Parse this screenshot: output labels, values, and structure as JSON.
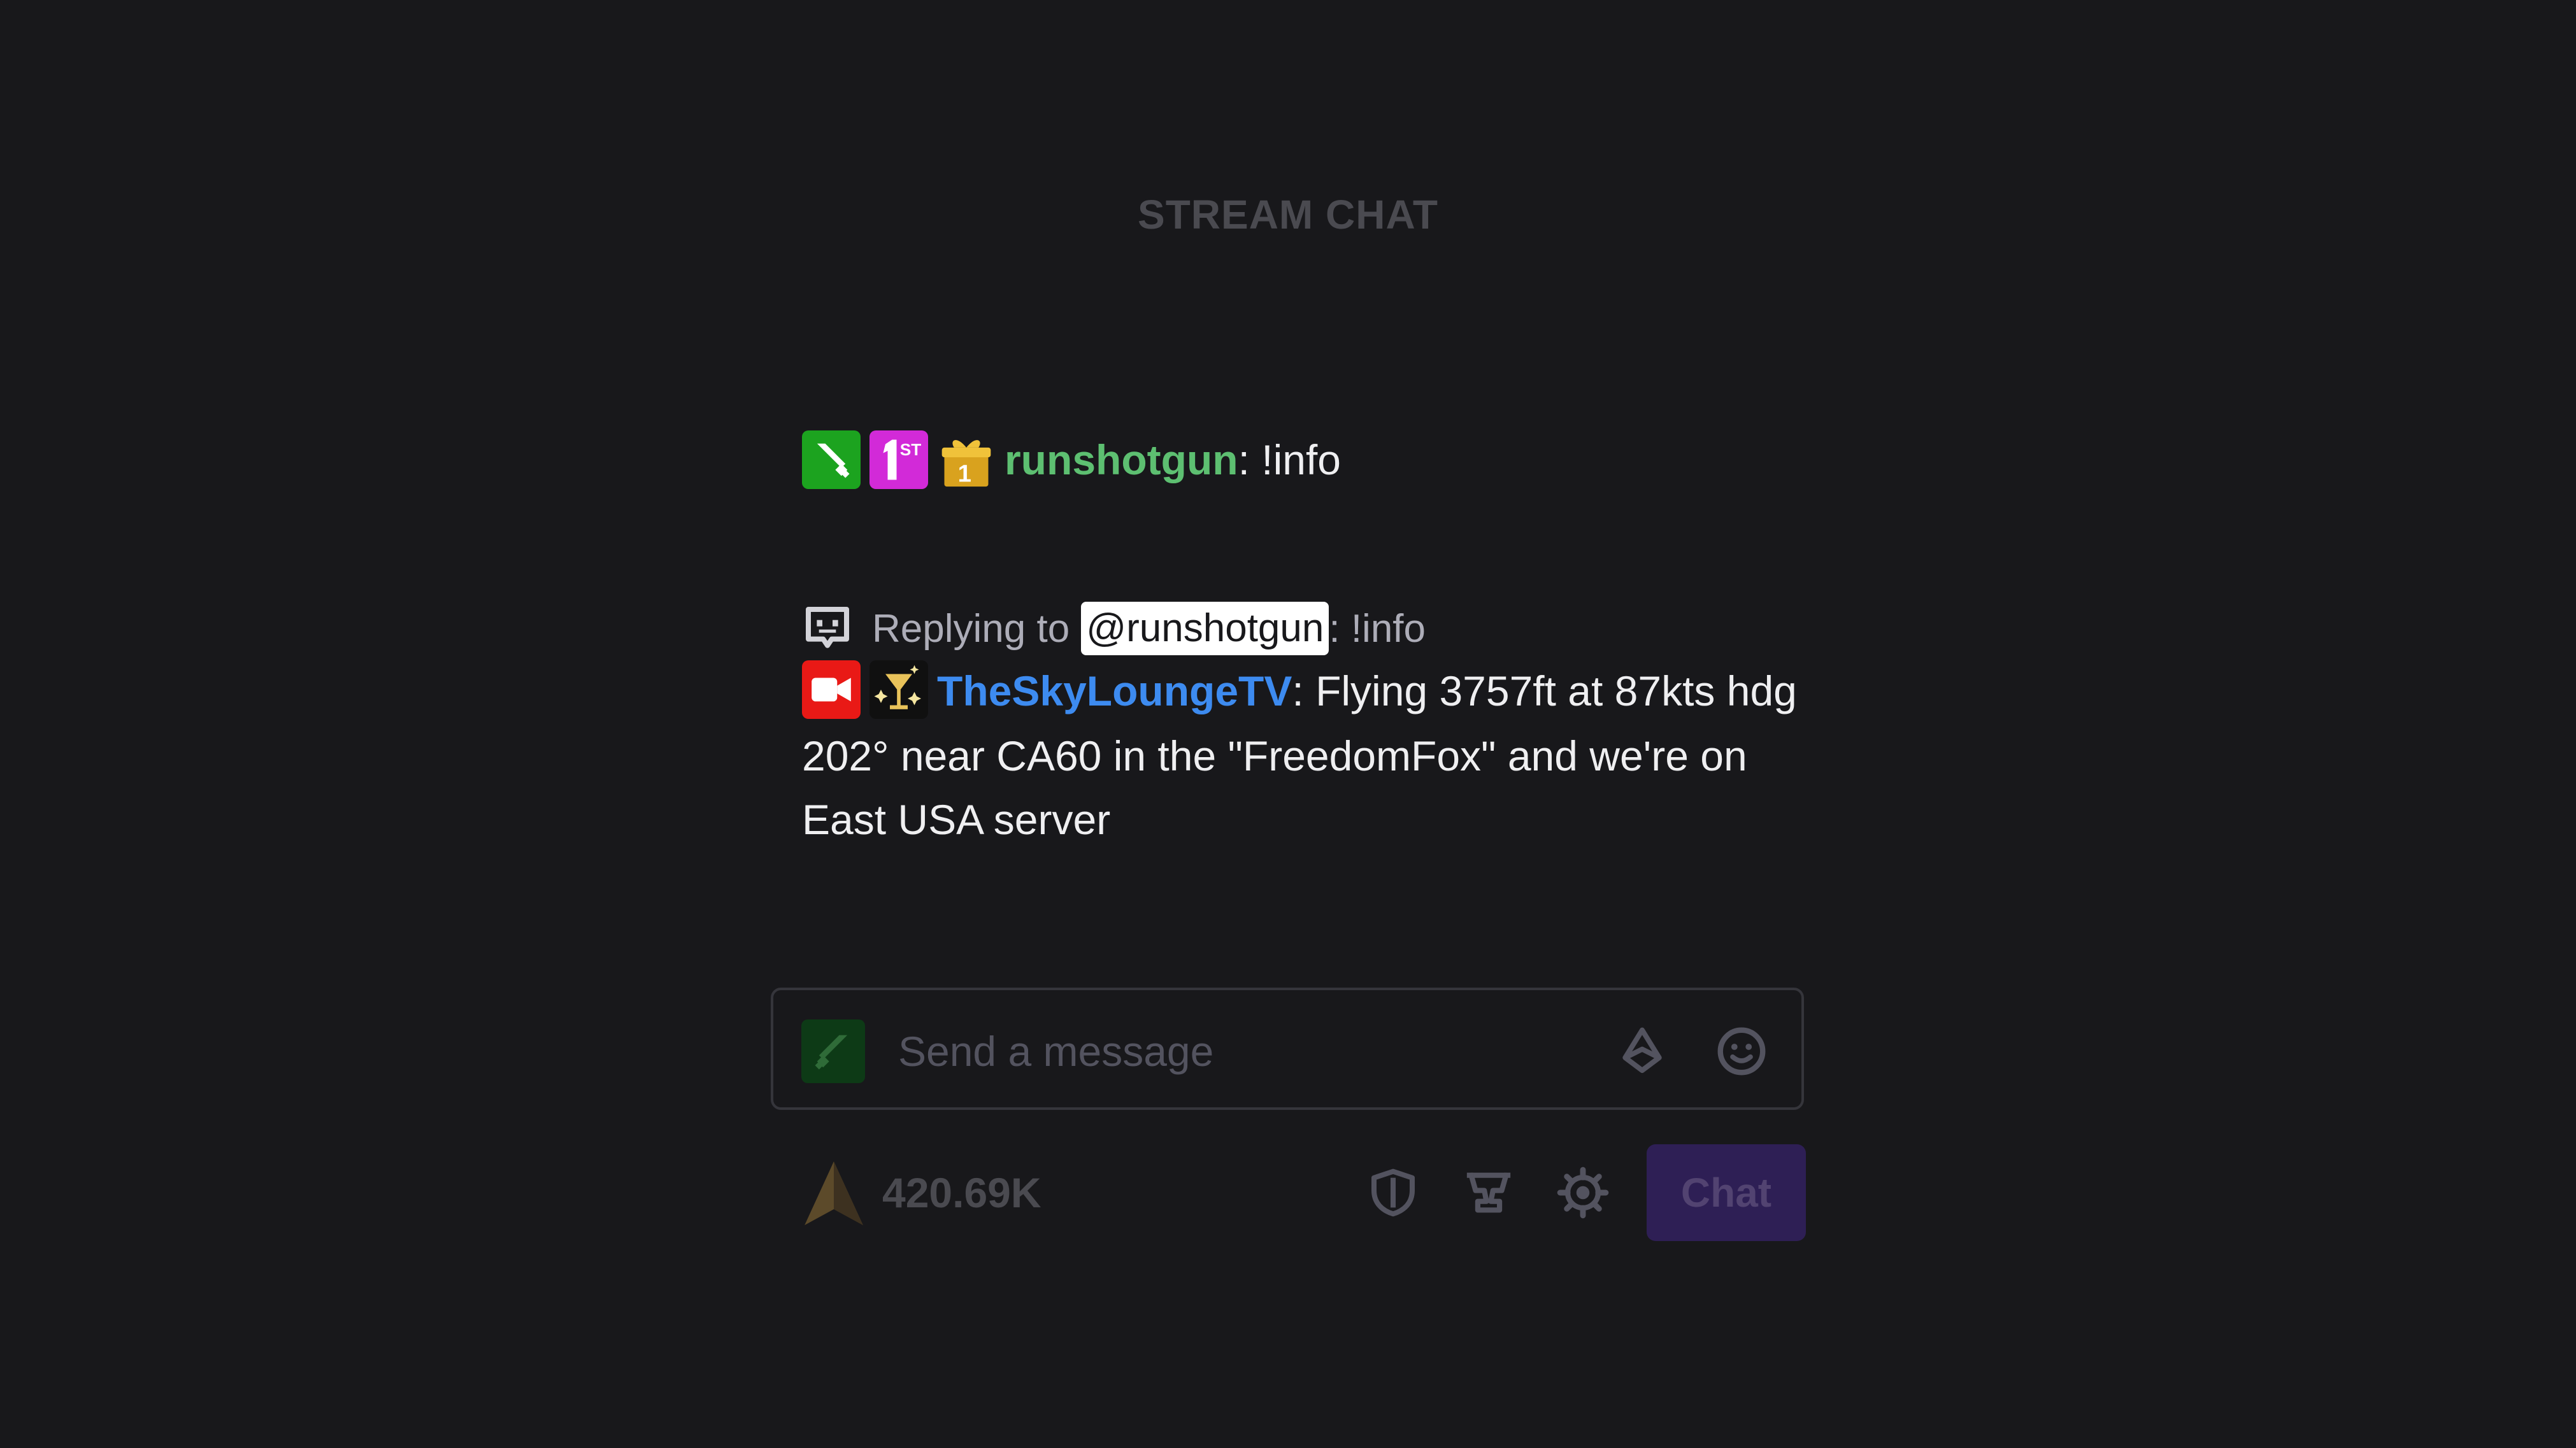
{
  "header": {
    "title": "STREAM CHAT"
  },
  "messages": [
    {
      "badges": [
        "moderator-sword-icon",
        "first-place-icon",
        "gift-sub-icon"
      ],
      "username": "runshotgun",
      "separator": ":",
      "text": "!info",
      "username_color": "#5dbf71"
    },
    {
      "reply": {
        "prefix": "Replying to",
        "mention": "@runshotgun",
        "quoted_text": ": !info"
      },
      "badges": [
        "broadcaster-camera-icon",
        "sparkle-cocktail-icon"
      ],
      "username": "TheSkyLoungeTV",
      "separator": ":",
      "text": "Flying 3757ft at 87kts hdg 202° near CA60 in the \"FreedomFox\" and we're on East USA server",
      "username_color": "#3d8bf0"
    }
  ],
  "input": {
    "placeholder": "Send a message",
    "badge_icon": "moderator-sword-icon",
    "bits_icon": "bits-diamond-icon",
    "emote_icon": "smiley-icon"
  },
  "bottom_bar": {
    "points_icon": "channel-points-icon",
    "points_value": "420.69K",
    "mod_icon": "shield-icon",
    "rewards_icon": "trophy-icon",
    "settings_icon": "gear-icon",
    "chat_button_label": "Chat"
  },
  "colors": {
    "background": "#18181b",
    "accent": "#9147ff",
    "chat_button_disabled": "#2e1f55",
    "mention_background": "#ffffff"
  }
}
